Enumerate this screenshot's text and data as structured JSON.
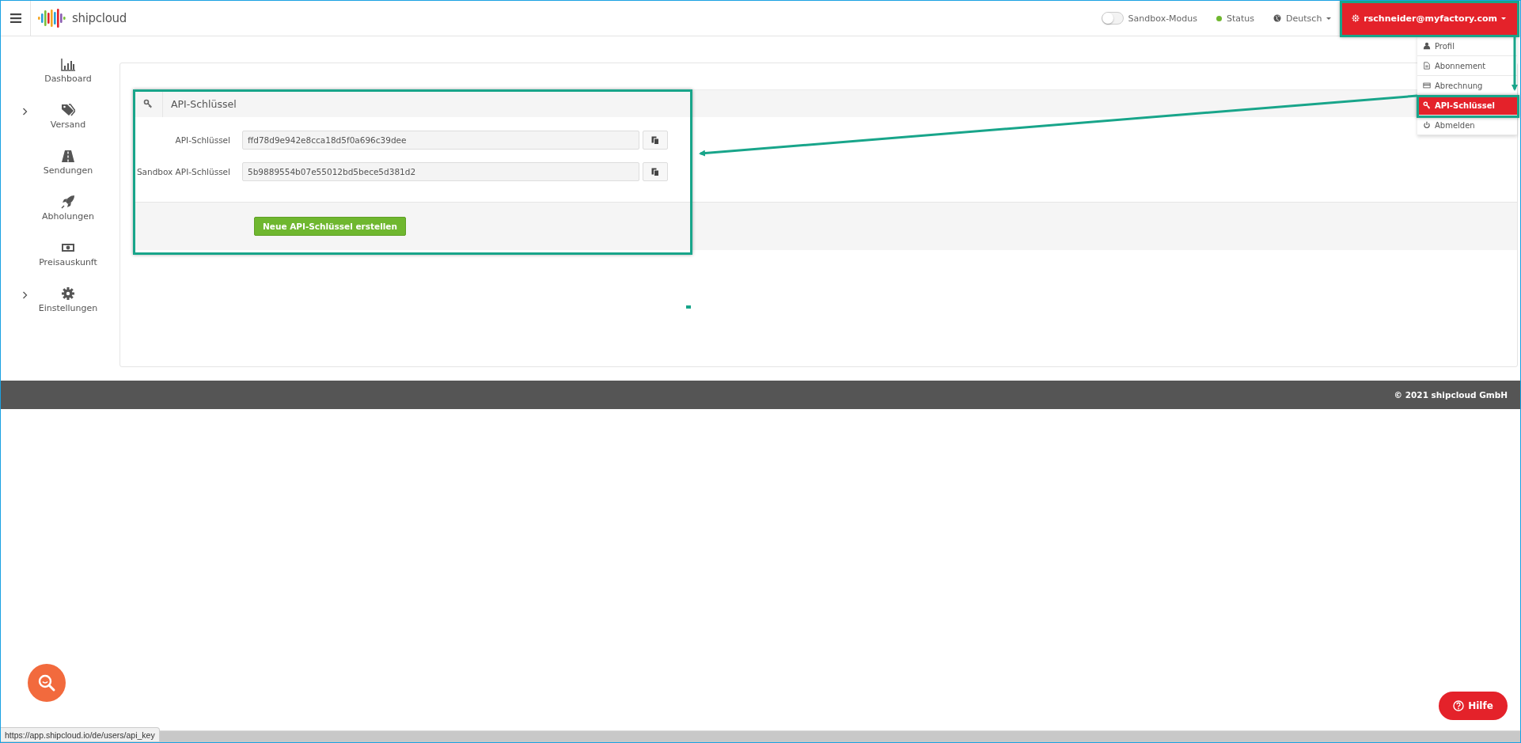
{
  "topbar": {
    "logo": "shipcloud",
    "sandbox": {
      "label": "Sandbox-Modus",
      "on": false
    },
    "status": "Status",
    "language": "Deutsch",
    "user": "rschneider@myfactory.com"
  },
  "user_menu": [
    {
      "label": "Profil",
      "selected": false
    },
    {
      "label": "Abonnement",
      "selected": false
    },
    {
      "label": "Abrechnung",
      "selected": false
    },
    {
      "label": "API-Schlüssel",
      "selected": true
    },
    {
      "label": "Abmelden",
      "selected": false
    }
  ],
  "sidebar": [
    {
      "label": "Dashboard",
      "expandable": false
    },
    {
      "label": "Versand",
      "expandable": true
    },
    {
      "label": "Sendungen",
      "expandable": false
    },
    {
      "label": "Abholungen",
      "expandable": false
    },
    {
      "label": "Preisauskunft",
      "expandable": false
    },
    {
      "label": "Einstellungen",
      "expandable": true
    }
  ],
  "panel": {
    "title": "API-Schlüssel",
    "fields": [
      {
        "label": "API-Schlüssel",
        "value": "ffd78d9e942e8cca18d5f0a696c39dee"
      },
      {
        "label": "Sandbox API-Schlüssel",
        "value": "5b9889554b07e55012bd5bece5d381d2"
      }
    ],
    "button": "Neue API-Schlüssel erstellen"
  },
  "footer": "© 2021 shipcloud GmbH",
  "help_button": "Hilfe",
  "status_url": "https://app.shipcloud.io/de/users/api_key"
}
